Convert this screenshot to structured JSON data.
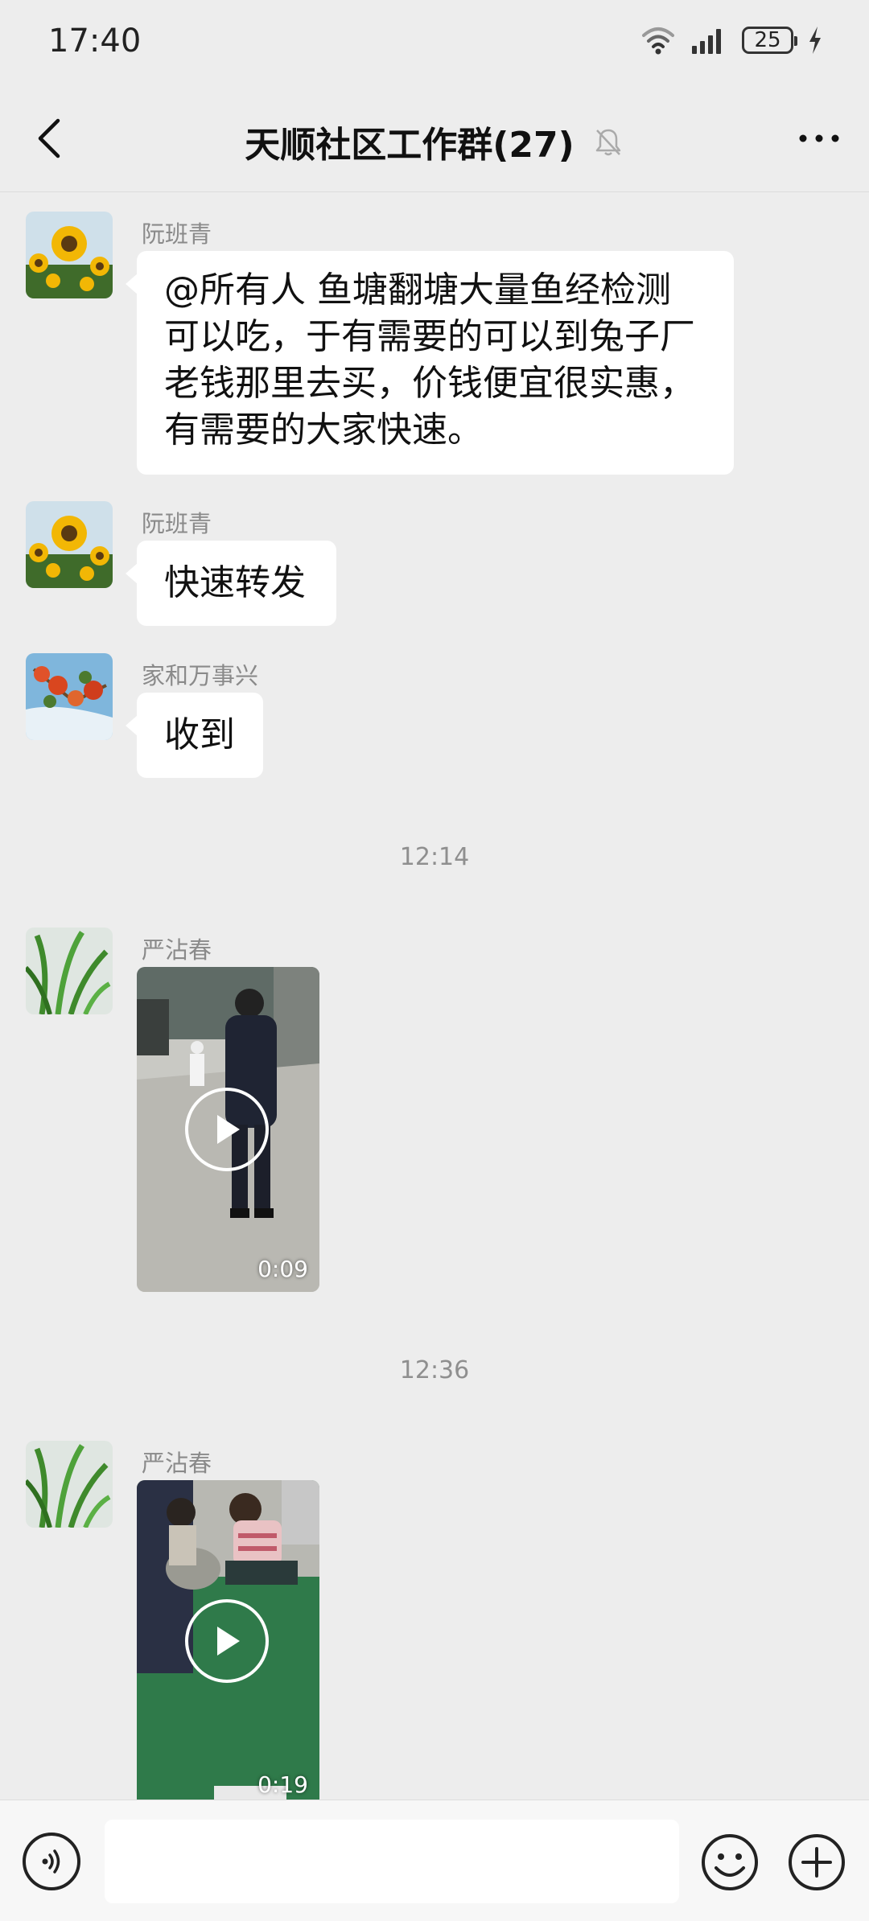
{
  "status_bar": {
    "time": "17:40",
    "battery": "25"
  },
  "header": {
    "title": "天顺社区工作群(27)"
  },
  "messages": [
    {
      "sender": "阮班青",
      "text": [
        "@所有人 鱼塘翻塘大量鱼经检测",
        "可以吃，于有需要的可以到兔子厂",
        "老钱那里去买，价钱便宜很实惠，",
        "有需要的大家快速。"
      ]
    },
    {
      "sender": "阮班青",
      "text": "快速转发"
    },
    {
      "sender": "家和万事兴",
      "text": "收到"
    },
    {
      "timestamp": "12:14"
    },
    {
      "sender": "严沾春",
      "video_duration": "0:09"
    },
    {
      "timestamp": "12:36"
    },
    {
      "sender": "严沾春",
      "video_duration": "0:19"
    }
  ],
  "colors": {
    "background": "#ededed",
    "bubble": "#ffffff",
    "sender_name": "#8a8a8a"
  },
  "icons": {
    "back": "chevron-left-icon",
    "mute": "bell-off-icon",
    "more": "more-dots-icon",
    "voice": "voice-icon",
    "emoji": "emoji-icon",
    "plus": "plus-icon",
    "play": "play-icon"
  }
}
